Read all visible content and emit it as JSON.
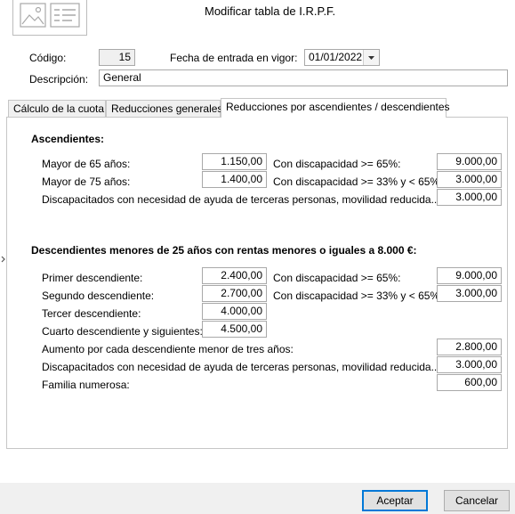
{
  "window": {
    "title": "Modificar tabla de I.R.P.F."
  },
  "header": {
    "codigo_label": "Código:",
    "codigo_value": "15",
    "fecha_label": "Fecha de entrada en vigor:",
    "fecha_value": "01/01/2022",
    "descripcion_label": "Descripción:",
    "descripcion_value": "General"
  },
  "tabs": [
    {
      "label": "Cálculo de la cuota"
    },
    {
      "label": "Reducciones generales"
    },
    {
      "label": "Reducciones por ascendientes / descendientes"
    }
  ],
  "ascendientes": {
    "title": "Ascendientes:",
    "mayor65_label": "Mayor de 65 años:",
    "mayor65_value": "1.150,00",
    "mayor75_label": "Mayor de 75 años:",
    "mayor75_value": "1.400,00",
    "disc65_label": "Con discapacidad >= 65%:",
    "disc65_value": "9.000,00",
    "disc33_label": "Con discapacidad >= 33% y < 65%:",
    "disc33_value": "3.000,00",
    "ayuda_label": "Discapacitados con necesidad de ayuda de terceras personas, movilidad reducida...:",
    "ayuda_value": "3.000,00"
  },
  "descendientes": {
    "title": "Descendientes menores de 25 años con rentas menores o iguales a 8.000 €:",
    "primero_label": "Primer descendiente:",
    "primero_value": "2.400,00",
    "segundo_label": "Segundo descendiente:",
    "segundo_value": "2.700,00",
    "tercero_label": "Tercer descendiente:",
    "tercero_value": "4.000,00",
    "cuarto_label": "Cuarto descendiente y siguientes:",
    "cuarto_value": "4.500,00",
    "disc65_label": "Con discapacidad >= 65%:",
    "disc65_value": "9.000,00",
    "disc33_label": "Con discapacidad >= 33% y < 65%:",
    "disc33_value": "3.000,00",
    "aumento_label": "Aumento por cada descendiente menor de tres años:",
    "aumento_value": "2.800,00",
    "ayuda_label": "Discapacitados con necesidad de ayuda de terceras personas, movilidad reducida...:",
    "ayuda_value": "3.000,00",
    "familia_label": "Familia numerosa:",
    "familia_value": "600,00"
  },
  "buttons": {
    "accept": "Aceptar",
    "cancel": "Cancelar"
  },
  "icons": {
    "header": "document-image-icon",
    "collapse": "chevron-right-icon",
    "dropdown": "chevron-down-icon"
  }
}
